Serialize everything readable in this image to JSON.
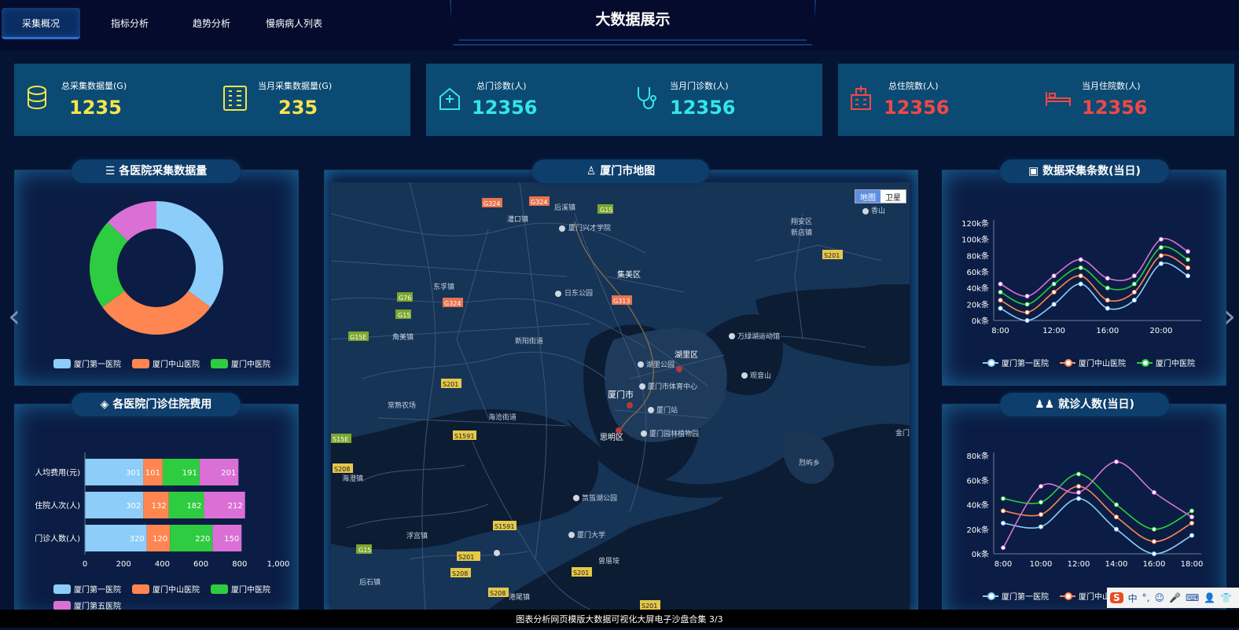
{
  "nav": {
    "tabs": [
      "采集概况",
      "指标分析",
      "趋势分析",
      "慢病病人列表"
    ],
    "active": 0
  },
  "page_title": "大数据展示",
  "stats": [
    {
      "label": "总采集数据量(G)",
      "value": "1235",
      "color": "#f5e54b",
      "icon": "database-icon"
    },
    {
      "label": "当月采集数据量(G)",
      "value": "235",
      "color": "#f5e54b",
      "icon": "server-icon"
    },
    {
      "label": "总门诊数(人)",
      "value": "12356",
      "color": "#33e6e6",
      "icon": "hospital-icon"
    },
    {
      "label": "当月门诊数(人)",
      "value": "12356",
      "color": "#33e6e6",
      "icon": "stethoscope-icon"
    },
    {
      "label": "总住院数(人)",
      "value": "12356",
      "color": "#f04848",
      "icon": "inpatient-icon"
    },
    {
      "label": "当月住院数(人)",
      "value": "12356",
      "color": "#f04848",
      "icon": "bed-icon"
    }
  ],
  "panels": {
    "pie": {
      "title": "各医院采集数据量",
      "icon": "list-icon"
    },
    "bar": {
      "title": "各医院门诊住院费用",
      "icon": "diamond-icon"
    },
    "map": {
      "title": "厦门市地图",
      "icon": "user-icon",
      "toggle": [
        "地图",
        "卫星"
      ]
    },
    "line1": {
      "title": "数据采集条数(当日)",
      "icon": "image-icon"
    },
    "line2": {
      "title": "就诊人数(当日)",
      "icon": "people-icon"
    }
  },
  "colors": {
    "h1": "#8ccdfa",
    "h2": "#ff8650",
    "h3": "#2ecc40",
    "h5": "#da70d6"
  },
  "chart_data": [
    {
      "type": "pie",
      "series": [
        {
          "name": "厦门第一医院",
          "value": 35,
          "color": "#8ccdfa"
        },
        {
          "name": "厦门中山医院",
          "value": 30,
          "color": "#ff8650"
        },
        {
          "name": "厦门中医院",
          "value": 22,
          "color": "#2ecc40"
        },
        {
          "name": "",
          "value": 13,
          "color": "#da70d6"
        }
      ],
      "legend": [
        "厦门第一医院",
        "厦门中山医院",
        "厦门中医院"
      ]
    },
    {
      "type": "bar",
      "categories": [
        "人均费用(元)",
        "住院人次(人)",
        "门诊人数(人)"
      ],
      "series": [
        {
          "name": "厦门第一医院",
          "values": [
            301,
            302,
            320
          ],
          "color": "#8ccdfa"
        },
        {
          "name": "厦门中山医院",
          "values": [
            101,
            132,
            120
          ],
          "color": "#ff8650"
        },
        {
          "name": "厦门中医院",
          "values": [
            191,
            182,
            220
          ],
          "color": "#2ecc40"
        },
        {
          "name": "厦门第五医院",
          "values": [
            201,
            212,
            150
          ],
          "color": "#da70d6"
        }
      ],
      "xticks": [
        "0",
        "200",
        "400",
        "600",
        "800",
        "1,000"
      ],
      "xlim": [
        0,
        1000
      ]
    },
    {
      "type": "line",
      "x": [
        8,
        10,
        12,
        14,
        16,
        18,
        20,
        22
      ],
      "xticks": [
        "8:00",
        "12:00",
        "16:00",
        "20:00"
      ],
      "xtick_values": [
        8,
        12,
        16,
        20
      ],
      "xlim": [
        7.5,
        23
      ],
      "yticks": [
        "0k条",
        "20k条",
        "40k条",
        "60k条",
        "80k条",
        "100k条",
        "120k条"
      ],
      "ylim": [
        0,
        120
      ],
      "series": [
        {
          "name": "厦门第一医院",
          "values": [
            15,
            0,
            20,
            45,
            15,
            25,
            70,
            55
          ],
          "color": "#8ccdfa"
        },
        {
          "name": "厦门中山医院",
          "values": [
            25,
            10,
            35,
            55,
            25,
            35,
            80,
            65
          ],
          "color": "#ff8650"
        },
        {
          "name": "厦门中医院",
          "values": [
            35,
            20,
            45,
            65,
            40,
            45,
            90,
            75
          ],
          "color": "#2ecc40"
        },
        {
          "name": "",
          "values": [
            45,
            30,
            55,
            75,
            52,
            55,
            100,
            85
          ],
          "color": "#da70d6"
        }
      ],
      "legend": [
        "厦门第一医院",
        "厦门中山医院",
        "厦门中医院"
      ]
    },
    {
      "type": "line",
      "x": [
        8,
        10,
        12,
        14,
        16,
        18
      ],
      "xticks": [
        "8:00",
        "10:00",
        "12:00",
        "14:00",
        "16:00",
        "18:00"
      ],
      "xtick_values": [
        8,
        10,
        12,
        14,
        16,
        18
      ],
      "xlim": [
        7.5,
        18.5
      ],
      "yticks": [
        "0k条",
        "20k条",
        "40k条",
        "60k条",
        "80k条"
      ],
      "ylim": [
        0,
        80
      ],
      "series": [
        {
          "name": "厦门第一医院",
          "values": [
            25,
            22,
            45,
            20,
            0,
            15
          ],
          "color": "#8ccdfa"
        },
        {
          "name": "厦门中山医院",
          "values": [
            35,
            32,
            55,
            30,
            10,
            25
          ],
          "color": "#ff8650"
        },
        {
          "name": "厦门中医院",
          "values": [
            45,
            42,
            65,
            40,
            20,
            35
          ],
          "color": "#2ecc40"
        },
        {
          "name": "",
          "values": [
            5,
            55,
            50,
            75,
            50,
            30
          ],
          "color": "#da70d6"
        }
      ],
      "legend": [
        "厦门第一医院",
        "厦门中山医院"
      ]
    }
  ],
  "map_labels": [
    "G324",
    "G324",
    "G15",
    "灌口镇",
    "后溪镇",
    "厦门兴才学院",
    "集美区",
    "日东公园",
    "G313",
    "东孚镇",
    "G324",
    "G76",
    "G15",
    "G15E",
    "角美镇",
    "新阳街道",
    "S201",
    "海沧街道",
    "常熟农场",
    "S1591",
    "S15E",
    "S208",
    "海澄镇",
    "S1591",
    "浮宫镇",
    "G15",
    "S208",
    "S208",
    "后石镇",
    "港尾镇",
    "S201",
    "S201",
    "湖里区",
    "湖里公园",
    "厦门市体育中心",
    "厦门市",
    "厦门站",
    "思明区",
    "厦门园林植物园",
    "万绿湖运动馆",
    "观音山",
    "翔安区",
    "新店镇",
    "香山",
    "S201",
    "鼓浪屿",
    "厦门大学",
    "海沧大桥",
    "S201",
    "烈屿乡",
    "金门",
    "筼筜湖公园",
    "曾厝垵"
  ],
  "footer": "图表分析网页模版大数据可视化大屏电子沙盘合集  3/3",
  "ime": [
    "S",
    "中",
    "°,",
    "☺",
    "🎤",
    "⌨",
    "👤",
    "👕"
  ]
}
